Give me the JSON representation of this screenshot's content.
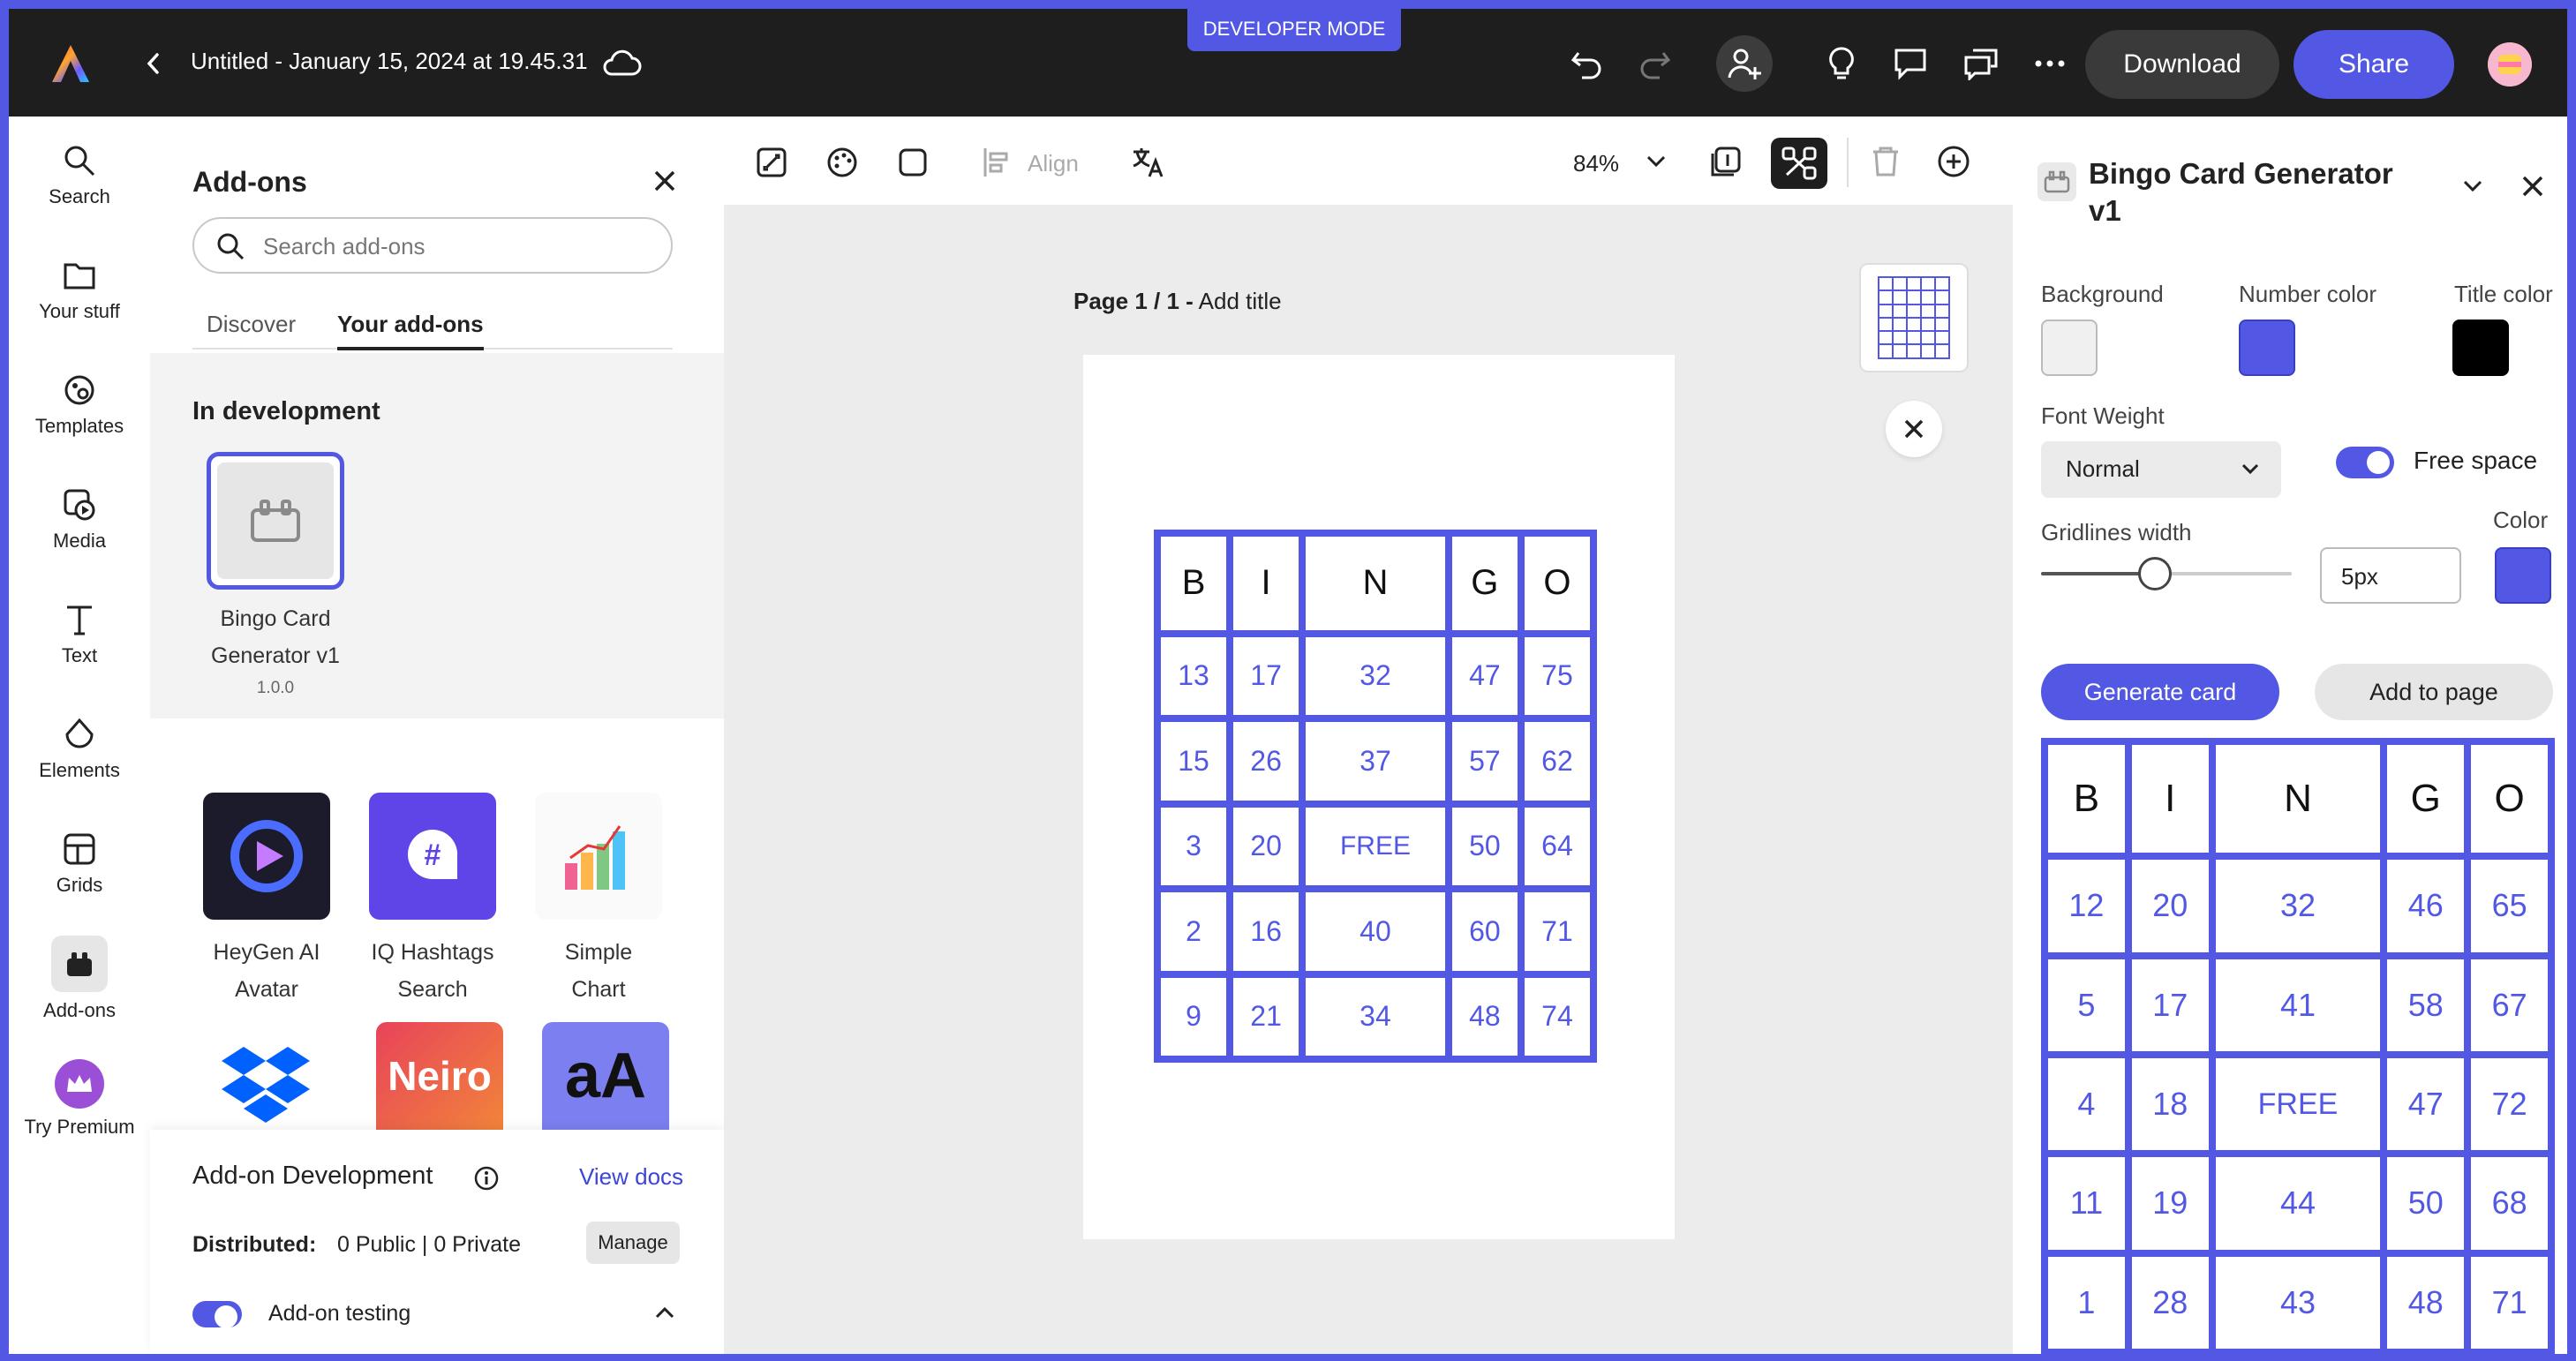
{
  "topbar": {
    "dev_mode": "DEVELOPER MODE",
    "title": "Untitled - January 15, 2024 at 19.45.31",
    "download": "Download",
    "share": "Share"
  },
  "rail": [
    {
      "label": "Search",
      "icon": "search-icon"
    },
    {
      "label": "Your stuff",
      "icon": "folder-icon"
    },
    {
      "label": "Templates",
      "icon": "templates-icon"
    },
    {
      "label": "Media",
      "icon": "media-icon"
    },
    {
      "label": "Text",
      "icon": "text-icon"
    },
    {
      "label": "Elements",
      "icon": "elements-icon"
    },
    {
      "label": "Grids",
      "icon": "grids-icon"
    },
    {
      "label": "Add-ons",
      "icon": "addons-icon"
    },
    {
      "label": "Try Premium",
      "icon": "crown-icon"
    }
  ],
  "addons": {
    "title": "Add-ons",
    "search_placeholder": "Search add-ons",
    "tabs": [
      "Discover",
      "Your add-ons"
    ],
    "in_dev_title": "In development",
    "dev_app_name_1": "Bingo Card",
    "dev_app_name_2": "Generator v1",
    "dev_app_version": "1.0.0",
    "apps": [
      {
        "name1": "HeyGen AI",
        "name2": "Avatar"
      },
      {
        "name1": "IQ Hashtags",
        "name2": "Search"
      },
      {
        "name1": "Simple",
        "name2": "Chart"
      }
    ],
    "neiro_label": "Neiro",
    "aa_label": "aA",
    "dev_section_title": "Add-on Development",
    "view_docs": "View docs",
    "distributed_label": "Distributed:",
    "distributed_value": "0 Public | 0 Private",
    "manage": "Manage",
    "testing": "Add-on testing"
  },
  "canvas": {
    "align": "Align",
    "zoom": "84%",
    "page_label": "Page 1 / 1 -",
    "add_title": "Add title",
    "bingo": [
      [
        "B",
        "I",
        "N",
        "G",
        "O"
      ],
      [
        "13",
        "17",
        "32",
        "47",
        "75"
      ],
      [
        "15",
        "26",
        "37",
        "57",
        "62"
      ],
      [
        "3",
        "20",
        "FREE",
        "50",
        "64"
      ],
      [
        "2",
        "16",
        "40",
        "60",
        "71"
      ],
      [
        "9",
        "21",
        "34",
        "48",
        "74"
      ]
    ]
  },
  "panel": {
    "title_line1": "Bingo Card Generator",
    "title_line2": "v1",
    "background": "Background",
    "number_color": "Number color",
    "title_color": "Title color",
    "colors": {
      "background": "#f0f0f0",
      "number": "#5258e4",
      "title": "#000000",
      "grid": "#5258e4"
    },
    "font_weight_label": "Font Weight",
    "font_weight_value": "Normal",
    "free_space": "Free space",
    "gridlines_label": "Gridlines width",
    "gridlines_value": "5px",
    "color_label": "Color",
    "generate": "Generate card",
    "add_to_page": "Add to page",
    "bingo": [
      [
        "B",
        "I",
        "N",
        "G",
        "O"
      ],
      [
        "12",
        "20",
        "32",
        "46",
        "65"
      ],
      [
        "5",
        "17",
        "41",
        "58",
        "67"
      ],
      [
        "4",
        "18",
        "FREE",
        "47",
        "72"
      ],
      [
        "11",
        "19",
        "44",
        "50",
        "68"
      ],
      [
        "1",
        "28",
        "43",
        "48",
        "71"
      ]
    ]
  }
}
